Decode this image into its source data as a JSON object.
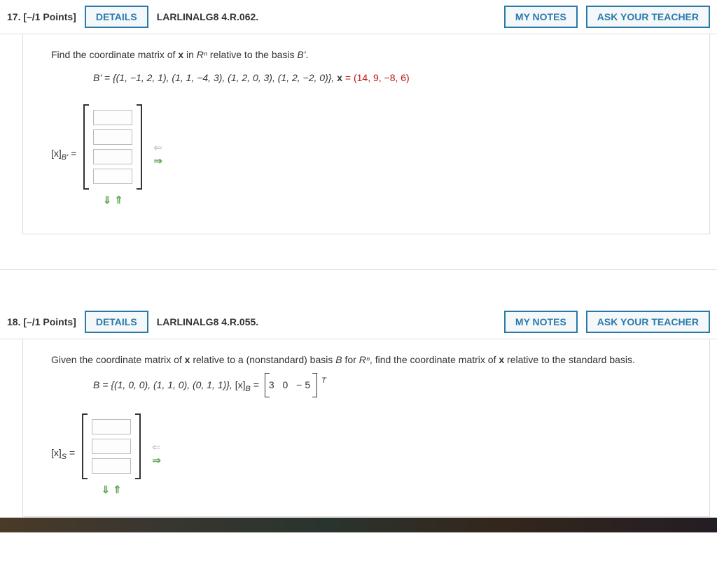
{
  "q17": {
    "number": "17.",
    "points": "[–/1 Points]",
    "details": "DETAILS",
    "reference": "LARLINALG8 4.R.062.",
    "mynotes": "MY NOTES",
    "ask": "ASK YOUR TEACHER",
    "prompt_a": "Find the coordinate matrix of ",
    "prompt_b": " in ",
    "prompt_c": " relative to the basis ",
    "prompt_d": ".",
    "x": "x",
    "Rn": "Rⁿ",
    "Bprime": "B'",
    "basis_line_pre": "B' = {(1, −1, 2, 1), (1, 1, −4, 3), (1, 2, 0, 3), (1, 2, −2, 0)},    ",
    "xeq": "x",
    "xval": " = (14, 9, −8, 6)",
    "answer_label_x": "[x]",
    "answer_label_sub": "B'",
    "answer_label_eq": " ="
  },
  "q18": {
    "number": "18.",
    "points": "[–/1 Points]",
    "details": "DETAILS",
    "reference": "LARLINALG8 4.R.055.",
    "mynotes": "MY NOTES",
    "ask": "ASK YOUR TEACHER",
    "prompt_a": "Given the coordinate matrix of ",
    "prompt_b": " relative to a (nonstandard) basis ",
    "prompt_c": " for ",
    "prompt_d": ", find the coordinate matrix of ",
    "prompt_e": " relative to the standard basis.",
    "x": "x",
    "B": "B",
    "Rn": "Rⁿ",
    "basis_line": "B = {(1, 0, 0), (1, 1, 0), (0, 1, 1)},    ",
    "xB_pre": "[x]",
    "xB_sub": "B",
    "xB_eq": " = ",
    "xB_vals": "3  0  −5",
    "xB_T": "T",
    "answer_label_x": "[x]",
    "answer_label_sub": "S",
    "answer_label_eq": " ="
  },
  "arrows": {
    "left": "⇐",
    "right": "⇒",
    "down": "⇓",
    "up": "⇑"
  }
}
